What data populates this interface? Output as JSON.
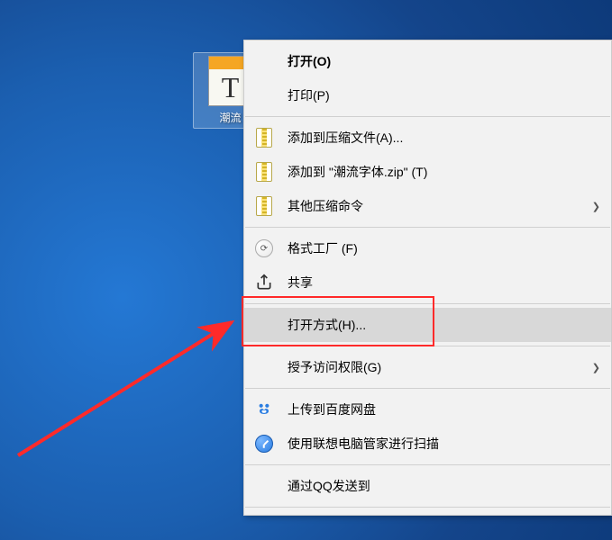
{
  "desktop": {
    "icon_label": "潮流"
  },
  "menu": {
    "open": "打开(O)",
    "print": "打印(P)",
    "add_archive": "添加到压缩文件(A)...",
    "add_zip": "添加到 \"潮流字体.zip\" (T)",
    "other_zip": "其他压缩命令",
    "format_factory": "格式工厂 (F)",
    "share": "共享",
    "open_with": "打开方式(H)...",
    "grant_access": "授予访问权限(G)",
    "baidu_upload": "上传到百度网盘",
    "lenovo_scan": "使用联想电脑管家进行扫描",
    "qq_send": "通过QQ发送到"
  }
}
